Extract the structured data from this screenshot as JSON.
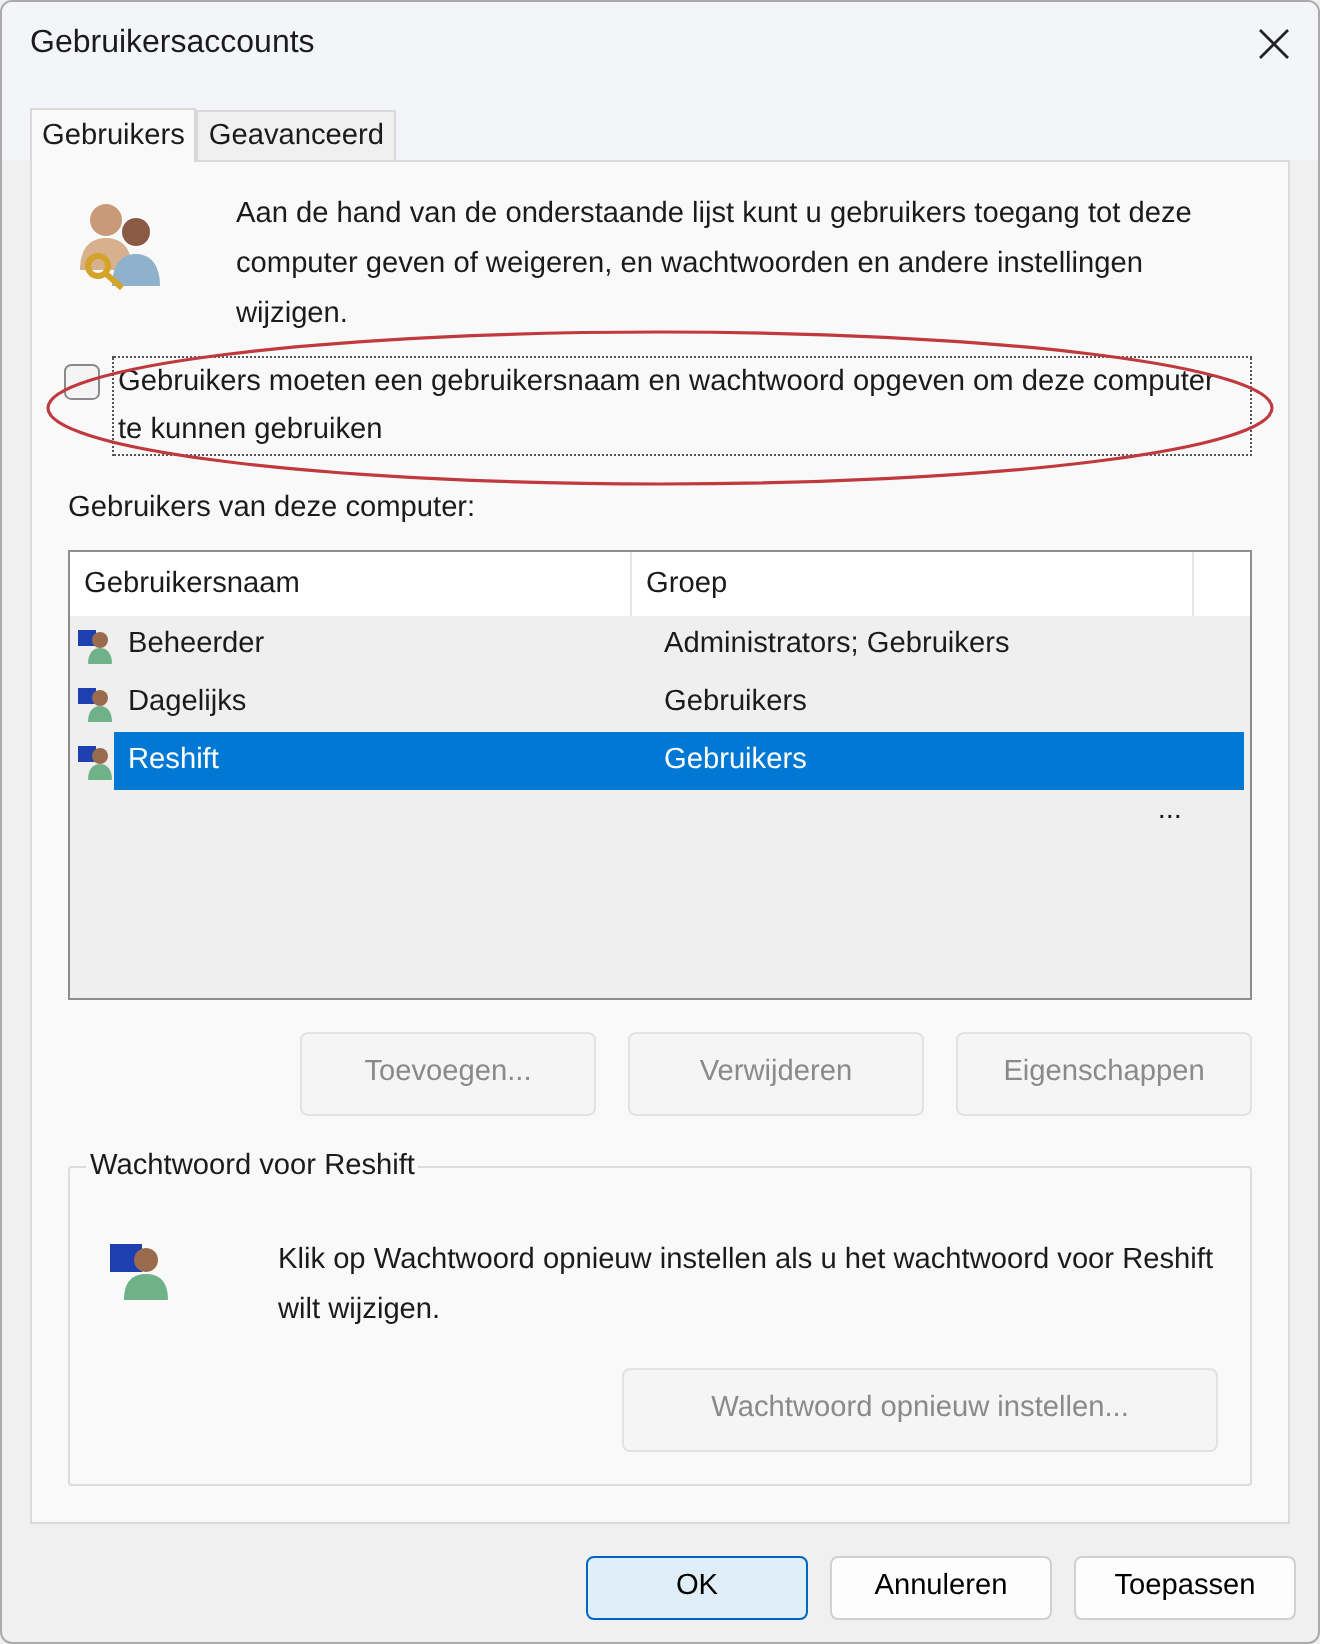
{
  "window": {
    "title": "Gebruikersaccounts"
  },
  "tabs": [
    {
      "label": "Gebruikers",
      "selected": true
    },
    {
      "label": "Geavanceerd",
      "selected": false
    }
  ],
  "intro": "Aan de hand van de onderstaande lijst kunt u gebruikers toegang tot deze computer geven of weigeren, en wachtwoorden en andere instellingen wijzigen.",
  "require_login": {
    "label": "Gebruikers moeten een gebruikersnaam en wachtwoord opgeven om deze computer te kunnen gebruiken",
    "checked": false,
    "annotation": {
      "kind": "ellipse"
    }
  },
  "users_label": "Gebruikers van deze computer:",
  "table": {
    "columns": [
      "Gebruikersnaam",
      "Groep"
    ],
    "rows": [
      {
        "cells": [
          "Beheerder",
          "Administrators; Gebruikers"
        ],
        "selected": false
      },
      {
        "cells": [
          "Dagelijks",
          "Gebruikers"
        ],
        "selected": false
      },
      {
        "cells": [
          "Reshift",
          "Gebruikers"
        ],
        "selected": true
      }
    ],
    "overflow_mark": "..."
  },
  "action_buttons": [
    {
      "label": "Toevoegen...",
      "disabled": true
    },
    {
      "label": "Verwijderen",
      "disabled": true
    },
    {
      "label": "Eigenschappen",
      "disabled": true
    }
  ],
  "password_group": {
    "title": "Wachtwoord voor Reshift",
    "text": "Klik op Wachtwoord opnieuw instellen als u het wachtwoord voor Reshift wilt wijzigen.",
    "button": {
      "label": "Wachtwoord opnieuw instellen...",
      "disabled": true
    }
  },
  "footer_buttons": [
    {
      "label": "OK",
      "default": true
    },
    {
      "label": "Annuleren",
      "default": false
    },
    {
      "label": "Toepassen",
      "default": false
    }
  ]
}
